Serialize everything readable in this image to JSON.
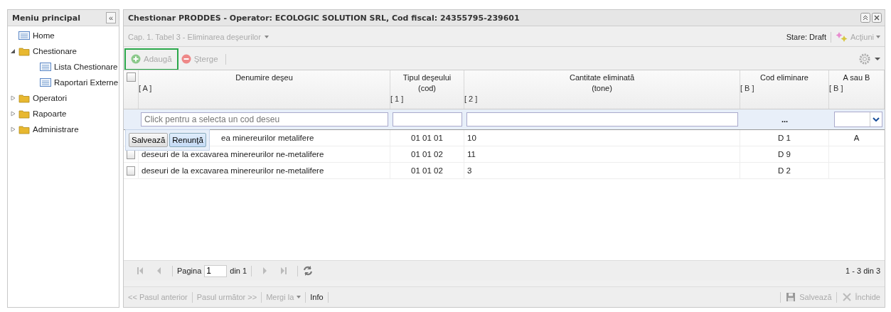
{
  "sidebar": {
    "title": "Meniu principal",
    "collapse_icon": "«",
    "items": [
      {
        "label": "Home",
        "kind": "page"
      },
      {
        "label": "Chestionare",
        "kind": "folder",
        "expanded": true,
        "children": [
          {
            "label": "Lista Chestionare",
            "kind": "page"
          },
          {
            "label": "Raportari Externe",
            "kind": "page"
          }
        ]
      },
      {
        "label": "Operatori",
        "kind": "folder",
        "expanded": false
      },
      {
        "label": "Rapoarte",
        "kind": "folder",
        "expanded": false
      },
      {
        "label": "Administrare",
        "kind": "folder",
        "expanded": false
      }
    ]
  },
  "window": {
    "title": "Chestionar PRODDES - Operator: ECOLOGIC SOLUTION SRL, Cod fiscal: 24355795-239601"
  },
  "breadcrumb": {
    "label": "Cap. 1. Tabel 3 - Eliminarea deşeurilor",
    "status": "Stare: Draft",
    "actions": "Acţiuni"
  },
  "toolbar": {
    "add": "Adaugă",
    "delete": "Şterge"
  },
  "table": {
    "all_checked": false,
    "columns": [
      {
        "title": "Denumire deşeu",
        "ref": "[ A ]"
      },
      {
        "title": "Tipul deşeului",
        "sub": "(cod)",
        "ref": "[ 1 ]"
      },
      {
        "title": "Cantitate eliminată",
        "sub": "(tone)",
        "ref": "[ 2 ]"
      },
      {
        "title": "Cod eliminare",
        "ref": "[ B ]"
      },
      {
        "title": "A sau B",
        "ref": "[ B ]"
      }
    ],
    "editor": {
      "placeholder": "Click pentru a selecta un cod deseu",
      "code_button": "...",
      "save": "Salvează",
      "cancel": "Renunţă"
    },
    "rows": [
      {
        "name": "ea minereurilor metalifere",
        "code": "01 01 01",
        "qty": "10",
        "elim": "D 1",
        "ab": "A"
      },
      {
        "checked": false,
        "name": "deseuri de la excavarea minereurilor ne-metalifere",
        "code": "01 01 02",
        "qty": "11",
        "elim": "D 9"
      },
      {
        "checked": false,
        "name": "deseuri de la excavarea minereurilor ne-metalifere",
        "code": "01 01 02",
        "qty": "3",
        "elim": "D 2"
      }
    ]
  },
  "pager": {
    "page_label": "Pagina",
    "page": "1",
    "of": "din 1",
    "summary": "1 - 3 din 3"
  },
  "footer": {
    "prev": "<< Pasul anterior",
    "next": "Pasul următor >>",
    "goto": "Mergi la",
    "info": "Info",
    "save": "Salvează",
    "close": "Închide"
  }
}
